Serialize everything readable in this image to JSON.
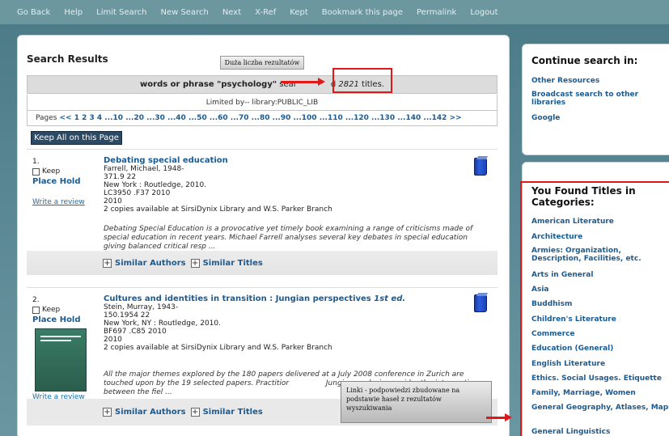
{
  "nav": [
    "Go Back",
    "Help",
    "Limit Search",
    "New Search",
    "Next",
    "X-Ref",
    "Kept",
    "Bookmark this page",
    "Permalink",
    "Logout"
  ],
  "results": {
    "title": "Search Results",
    "callout": "Duża liczba rezultatów",
    "query_prefix": "words or phrase ",
    "query_term": "\"psychology\"",
    "query_mid": " sear",
    "query_found": "d ",
    "query_count": "2821",
    "query_suffix": " titles.",
    "limited_by": "Limited by-- library:PUBLIC_LIB",
    "pages_label": "Pages",
    "pages_nav": "<< 1 2 3 4 ...10 ...20 ...30 ...40 ...50 ...60 ...70 ...80 ...90 ...100 ...110 ...120 ...130 ...140 ...142 >>",
    "keep_all": "Keep All on this Page"
  },
  "items": [
    {
      "num": "1.",
      "keep": "Keep",
      "hold": "Place Hold",
      "review": "Write a review",
      "title": "Debating special education",
      "title_ed": "",
      "lines": [
        "Farrell, Michael, 1948-",
        "371.9 22",
        "New York : Routledge, 2010.",
        "LC3950 .F37 2010",
        "2010",
        "2 copies available at SirsiDynix Library and W.S. Parker Branch"
      ],
      "summary": "Debating Special Education is a provocative yet timely book examining a range of criticisms made of special education in recent years. Michael Farrell analyses several key debates in special education giving balanced critical resp ...",
      "sim_authors": "Similar Authors",
      "sim_titles": "Similar Titles"
    },
    {
      "num": "2.",
      "keep": "Keep",
      "hold": "Place Hold",
      "review": "Write a review",
      "title": "Cultures and identities in transition : Jungian perspectives",
      "title_ed": "1st ed.",
      "lines": [
        "Stein, Murray, 1943-",
        "150.1954 22",
        "New York, NY : Routledge, 2010.",
        "BF697 .C85 2010",
        "2010",
        "2 copies available at SirsiDynix Library and W.S. Parker Branch"
      ],
      "summary": "All the major themes explored by the 180 papers delivered at a July 2008 conference in Zurich are touched upon by the 19 selected papers. Practitior                Jungian analysis consider the intersection between the fiel ...",
      "sim_authors": "Similar Authors",
      "sim_titles": "Similar Titles"
    }
  ],
  "callout2": "Linki - podpowiedzi zbudowane na podstawie haseł z rezultatów wyszukiwania",
  "continue": {
    "title": "Continue search in:",
    "links": [
      "Other Resources",
      "Broadcast search to other libraries",
      "Google"
    ]
  },
  "categories": {
    "title": "You Found Titles in Categories:",
    "items": [
      "American Literature",
      "Architecture",
      "Armies: Organization, Description, Facilities, etc.",
      "Arts in General",
      "Asia",
      "Buddhism",
      "Children's Literature",
      "Commerce",
      "Education (General)",
      "English Literature",
      "Ethics. Social Usages. Etiquette",
      "Family, Marriage, Women",
      "General Geography, Atlases, Maps",
      "General Linguistics"
    ]
  },
  "colors": {
    "accent": "#1b5b92",
    "highlight": "#e21818",
    "nav_bg": "#6d979f"
  }
}
